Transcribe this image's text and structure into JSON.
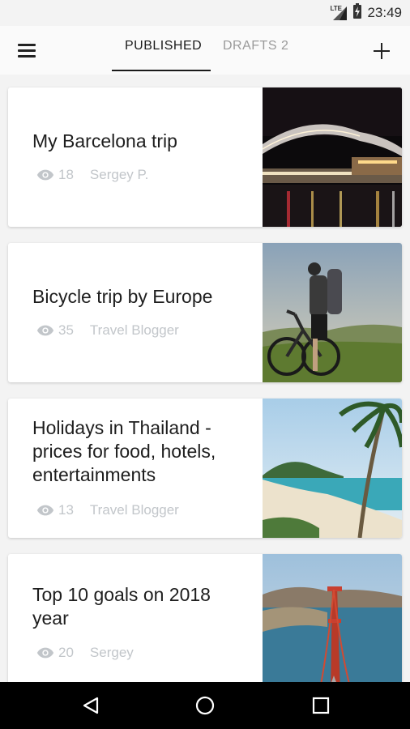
{
  "status": {
    "network": "LTE",
    "time": "23:49"
  },
  "tabs": [
    {
      "label": "PUBLISHED",
      "active": true
    },
    {
      "label": "DRAFTS 2",
      "active": false
    }
  ],
  "colors": {
    "meta": "#c2c6ca",
    "title": "#1e1e1e",
    "tab_active": "#1a1a1a",
    "tab_inactive": "#9a9a9a"
  },
  "posts": [
    {
      "title": "My Barcelona trip",
      "views": "18",
      "author": "Sergey P.",
      "image": "night-bridge-harbor-photo"
    },
    {
      "title": "Bicycle trip by Europe",
      "views": "35",
      "author": "Travel Blogger",
      "image": "cyclist-mountain-photo"
    },
    {
      "title": "Holidays in Thailand - prices for food, hotels, entertainments",
      "views": "13",
      "author": "Travel Blogger",
      "image": "tropical-beach-palm-photo"
    },
    {
      "title": "Top 10 goals on 2018 year",
      "views": "20",
      "author": "Sergey",
      "image": "golden-gate-bridge-photo"
    }
  ],
  "nav": {
    "back": "back-icon",
    "home": "home-icon",
    "recents": "recents-icon"
  }
}
